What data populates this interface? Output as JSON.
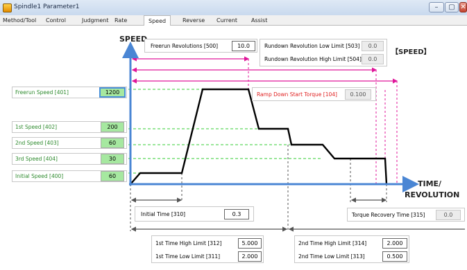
{
  "window": {
    "title": "Spindle1 Parameter1",
    "min": "–",
    "max": "▢",
    "close": "✕"
  },
  "tabs": [
    "Method/Tool",
    "Control",
    "Judgment",
    "Rate",
    "Speed",
    "Reverse",
    "Current",
    "Assist"
  ],
  "active_tab": "Speed",
  "axis": {
    "speed": "SPEED",
    "time_line1": "TIME/",
    "time_line2": "REVOLUTION"
  },
  "section_title": "【SPEED】",
  "params": {
    "freerun_revolutions": {
      "label": "Freerun Revolutions [500]",
      "value": "10.0"
    },
    "rundown_low": {
      "label": "Rundown Revolution Low Limit [503]",
      "value": "0.0"
    },
    "rundown_high": {
      "label": "Rundown Revolution High Limit [504]",
      "value": "0.0"
    },
    "ramp_down_torque": {
      "label": "Ramp Down Start Torque [104]",
      "value": "0.100"
    },
    "freerun_speed": {
      "label": "Freerun Speed [401]",
      "value": "1200"
    },
    "speed1": {
      "label": "1st Speed [402]",
      "value": "200"
    },
    "speed2": {
      "label": "2nd Speed [403]",
      "value": "60"
    },
    "speed3": {
      "label": "3rd Speed [404]",
      "value": "30"
    },
    "initial_speed": {
      "label": "Initial Speed [400]",
      "value": "60"
    },
    "initial_time": {
      "label": "Initial Time [310]",
      "value": "0.3"
    },
    "torque_recovery": {
      "label": "Torque Recovery Time [315]",
      "value": "0.0"
    },
    "t1_high": {
      "label": "1st Time High Limit [312]",
      "value": "5.000"
    },
    "t1_low": {
      "label": "1st Time Low Limit [311]",
      "value": "2.000"
    },
    "t2_high": {
      "label": "2nd Time High Limit [314]",
      "value": "2.000"
    },
    "t2_low": {
      "label": "2nd Time Low Limit [313]",
      "value": "0.500"
    }
  },
  "colors": {
    "axis": "#4a86d4",
    "profile": "#000000",
    "green_guide": "#33cc33",
    "magenta": "#e0169a",
    "gray_guide": "#555555"
  }
}
